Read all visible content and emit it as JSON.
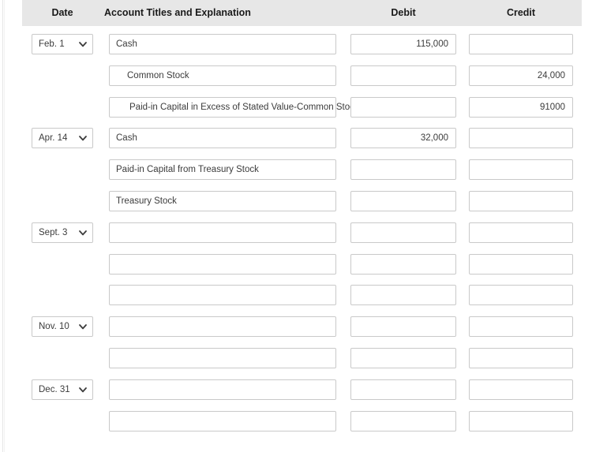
{
  "table": {
    "columns": {
      "date": "Date",
      "account": "Account Titles and Explanation",
      "debit": "Debit",
      "credit": "Credit"
    },
    "header_background": "#e7e7e7",
    "border_color": "#c9c9c9",
    "text_color": "#3c3c3c",
    "chevron_icon": "chevron-down-icon",
    "rows": [
      {
        "date": "Feb. 1",
        "account": "Cash",
        "indent": 0,
        "debit": "115,000",
        "credit": ""
      },
      {
        "date": "",
        "account": "Common Stock",
        "indent": 1,
        "debit": "",
        "credit": "24,000"
      },
      {
        "date": "",
        "account": "Paid-in Capital in Excess of Stated Value-Common Stock",
        "indent": 2,
        "debit": "",
        "credit": "91000"
      },
      {
        "date": "Apr. 14",
        "account": "Cash",
        "indent": 0,
        "debit": "32,000",
        "credit": ""
      },
      {
        "date": "",
        "account": "Paid-in Capital from Treasury Stock",
        "indent": 0,
        "debit": "",
        "credit": ""
      },
      {
        "date": "",
        "account": "Treasury Stock",
        "indent": 0,
        "debit": "",
        "credit": ""
      },
      {
        "date": "Sept. 3",
        "account": "",
        "indent": 0,
        "debit": "",
        "credit": ""
      },
      {
        "date": "",
        "account": "",
        "indent": 0,
        "debit": "",
        "credit": ""
      },
      {
        "date": "",
        "account": "",
        "indent": 0,
        "debit": "",
        "credit": ""
      },
      {
        "date": "Nov. 10",
        "account": "",
        "indent": 0,
        "debit": "",
        "credit": ""
      },
      {
        "date": "",
        "account": "",
        "indent": 0,
        "debit": "",
        "credit": ""
      },
      {
        "date": "Dec. 31",
        "account": "",
        "indent": 0,
        "debit": "",
        "credit": ""
      },
      {
        "date": "",
        "account": "",
        "indent": 0,
        "debit": "",
        "credit": ""
      }
    ]
  }
}
